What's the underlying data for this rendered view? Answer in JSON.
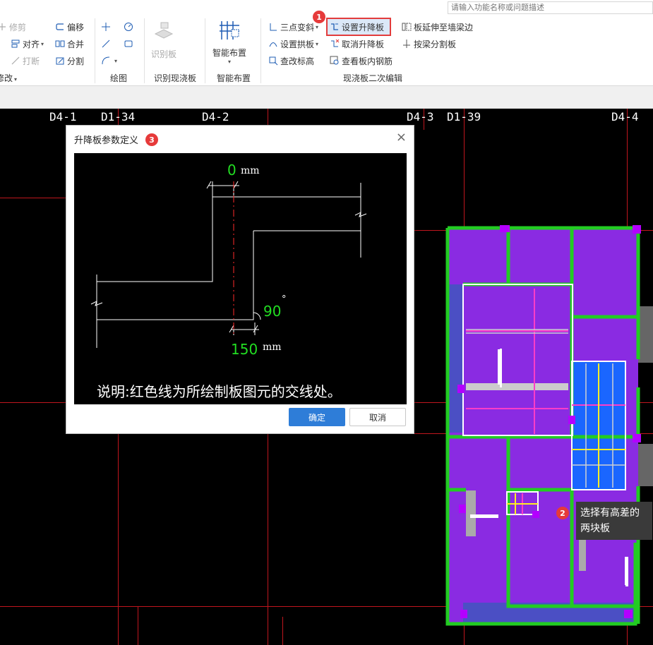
{
  "search": {
    "placeholder": "请输入功能名称或问题描述"
  },
  "ribbon": {
    "modify": {
      "items": [
        "修剪",
        "偏移",
        "对齐",
        "合并",
        "打断",
        "分割"
      ],
      "group": "修改"
    },
    "draw": {
      "group": "绘图"
    },
    "recognize": {
      "button": "识别板",
      "group": "识别现浇板"
    },
    "smart": {
      "button": "智能布置",
      "group": "智能布置"
    },
    "edit": {
      "three_point": "三点变斜",
      "set_lift": "设置升降板",
      "extend": "板延伸至墙梁边",
      "set_arch": "设置拱板",
      "cancel_lift": "取消升降板",
      "split_by_beam": "按梁分割板",
      "check_elev": "查改标高",
      "view_rebar": "查看板内钢筋",
      "group": "现浇板二次编辑"
    }
  },
  "badges": [
    "1",
    "2",
    "3"
  ],
  "axes": [
    "D4-1",
    "D1-34",
    "D4-2",
    "D4-3",
    "D1-39",
    "D4-4"
  ],
  "tooltip": {
    "line1": "选择有高差的",
    "line2": "两块板"
  },
  "dialog": {
    "title": "升降板参数定义",
    "close": "×",
    "diagram": {
      "top_value": "0",
      "top_unit": "mm",
      "angle": "90",
      "degree": "°",
      "bottom_value": "150",
      "bottom_unit": "mm",
      "note": "说明:红色线为所绘制板图元的交线处。"
    },
    "ok": "确定",
    "cancel": "取消"
  },
  "colors": {
    "accent": "#2e7dd8",
    "highlight": "#e23c3c",
    "gridline": "#c0161e",
    "slab": "#8a2be2",
    "wall": "#22cc22",
    "blue_slab": "#1a66ff"
  }
}
